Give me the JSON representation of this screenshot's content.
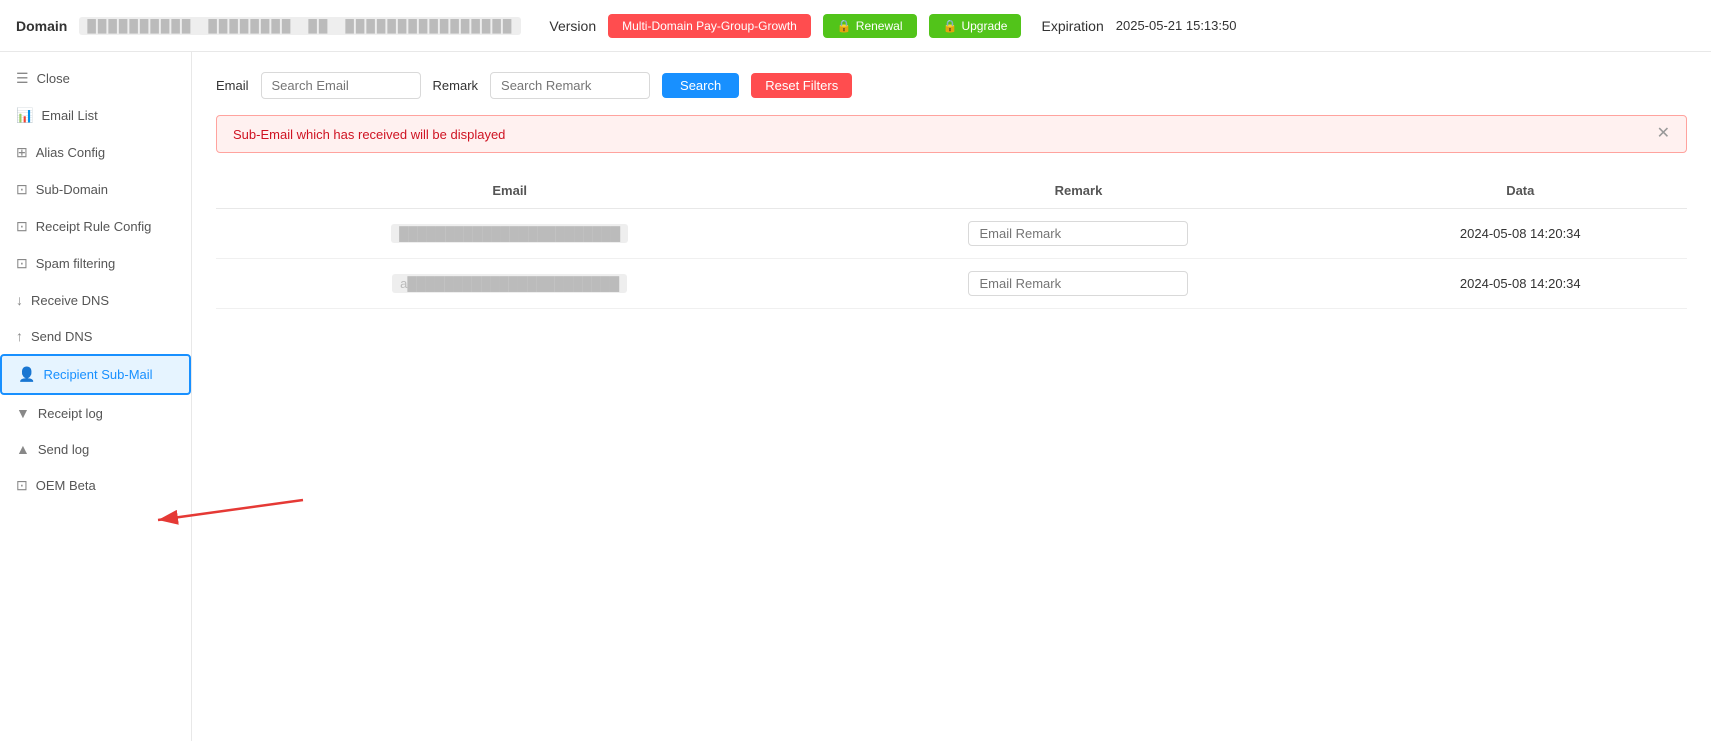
{
  "topbar": {
    "domain_label": "Domain",
    "domain_value": "██████████ ████████ ██ ██████████████",
    "version_label": "Version",
    "version_btn": "Multi-Domain Pay-Group-Growth",
    "renewal_btn": "Renewal",
    "upgrade_btn": "Upgrade",
    "expiration_label": "Expiration",
    "expiration_value": "2025-05-21 15:13:50"
  },
  "sidebar": {
    "items": [
      {
        "id": "close",
        "label": "Close",
        "icon": "☰"
      },
      {
        "id": "email-list",
        "label": "Email List",
        "icon": "📊"
      },
      {
        "id": "alias-config",
        "label": "Alias Config",
        "icon": "⊞"
      },
      {
        "id": "sub-domain",
        "label": "Sub-Domain",
        "icon": "⊡"
      },
      {
        "id": "receipt-rule-config",
        "label": "Receipt Rule Config",
        "icon": "⊡"
      },
      {
        "id": "spam-filtering",
        "label": "Spam filtering",
        "icon": "⊡"
      },
      {
        "id": "receive-dns",
        "label": "Receive DNS",
        "icon": "↓"
      },
      {
        "id": "send-dns",
        "label": "Send DNS",
        "icon": "↑"
      },
      {
        "id": "recipient-sub-mail",
        "label": "Recipient Sub-Mail",
        "icon": "👤",
        "active": true
      },
      {
        "id": "receipt-log",
        "label": "Receipt log",
        "icon": "▼"
      },
      {
        "id": "send-log",
        "label": "Send log",
        "icon": "▲"
      },
      {
        "id": "oem",
        "label": "OEM Beta",
        "icon": "⊡"
      }
    ]
  },
  "filters": {
    "email_label": "Email",
    "email_placeholder": "Search Email",
    "remark_label": "Remark",
    "remark_placeholder": "Search Remark",
    "search_btn": "Search",
    "reset_btn": "Reset Filters"
  },
  "alert": {
    "message": "Sub-Email which has received will be displayed"
  },
  "table": {
    "columns": [
      "Email",
      "Remark",
      "Data"
    ],
    "rows": [
      {
        "email": "████████████████████████",
        "remark_placeholder": "Email Remark",
        "date": "2024-05-08 14:20:34"
      },
      {
        "email": "a███████████████████████",
        "remark_placeholder": "Email Remark",
        "date": "2024-05-08 14:20:34"
      }
    ]
  }
}
